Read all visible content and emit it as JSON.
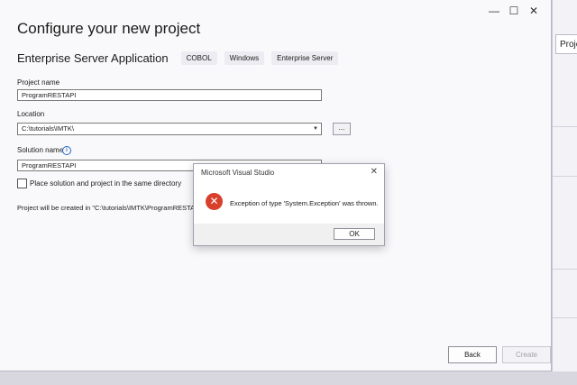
{
  "window": {
    "minimize_glyph": "—",
    "maximize_glyph": "☐",
    "close_glyph": "✕",
    "page_title": "Configure your new project"
  },
  "template": {
    "name": "Enterprise Server Application",
    "tags": [
      "COBOL",
      "Windows",
      "Enterprise Server"
    ]
  },
  "form": {
    "project_name_label": "Project name",
    "project_name_value": "ProgramRESTAPI",
    "location_label": "Location",
    "location_value": "C:\\tutorials\\IMTK\\",
    "browse_label": "...",
    "solution_name_label": "Solution name",
    "solution_name_value": "ProgramRESTAPI",
    "same_dir_label": "Place solution and project in the same directory",
    "created_info": "Project will be created in \"C:\\tutorials\\IMTK\\ProgramRESTAPI\\\""
  },
  "footer": {
    "back_label": "Back",
    "create_label": "Create"
  },
  "msgbox": {
    "title": "Microsoft Visual Studio",
    "close_glyph": "✕",
    "icon_glyph": "✕",
    "message": "Exception of type 'System.Exception' was thrown.",
    "ok_label": "OK"
  },
  "background": {
    "tab_label": "Proje"
  },
  "colors": {
    "error": "#d8402b",
    "accent": "#2a66c7"
  }
}
